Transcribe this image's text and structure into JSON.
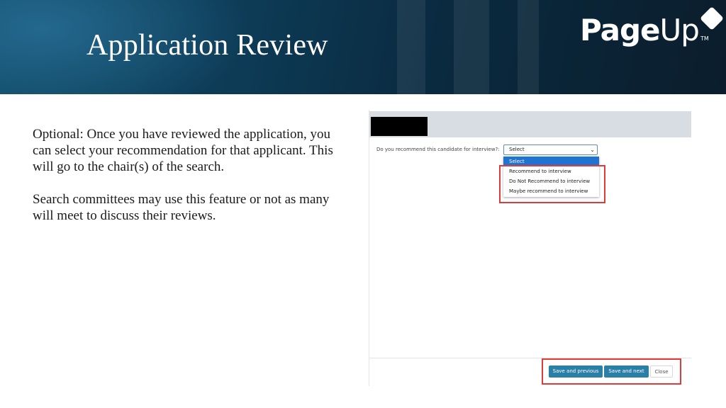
{
  "header": {
    "title": "Application Review",
    "logo_bold": "Page",
    "logo_thin": "Up",
    "logo_tm": "TM"
  },
  "body": {
    "paragraph1": "Optional: Once you have reviewed the application, you can select your recommendation for that applicant. This will go to the chair(s) of the search.",
    "paragraph2": "Search committees may use this feature or not as many will meet to discuss their reviews."
  },
  "screenshot": {
    "question_label": "Do you recommend this candidate for interview?:",
    "select_value": "Select",
    "options": [
      "Select",
      "Recommend to interview",
      "Do Not Recommend to interview",
      "Maybe recommend to interview"
    ],
    "buttons": {
      "save_previous": "Save and previous",
      "save_next": "Save and next",
      "close": "Close"
    }
  },
  "colors": {
    "header_dark": "#0b1d2c",
    "header_teal": "#0f4a66",
    "highlight_red": "#e03a3a",
    "primary_button": "#2a7fa7",
    "selected_option": "#1f73d1"
  }
}
